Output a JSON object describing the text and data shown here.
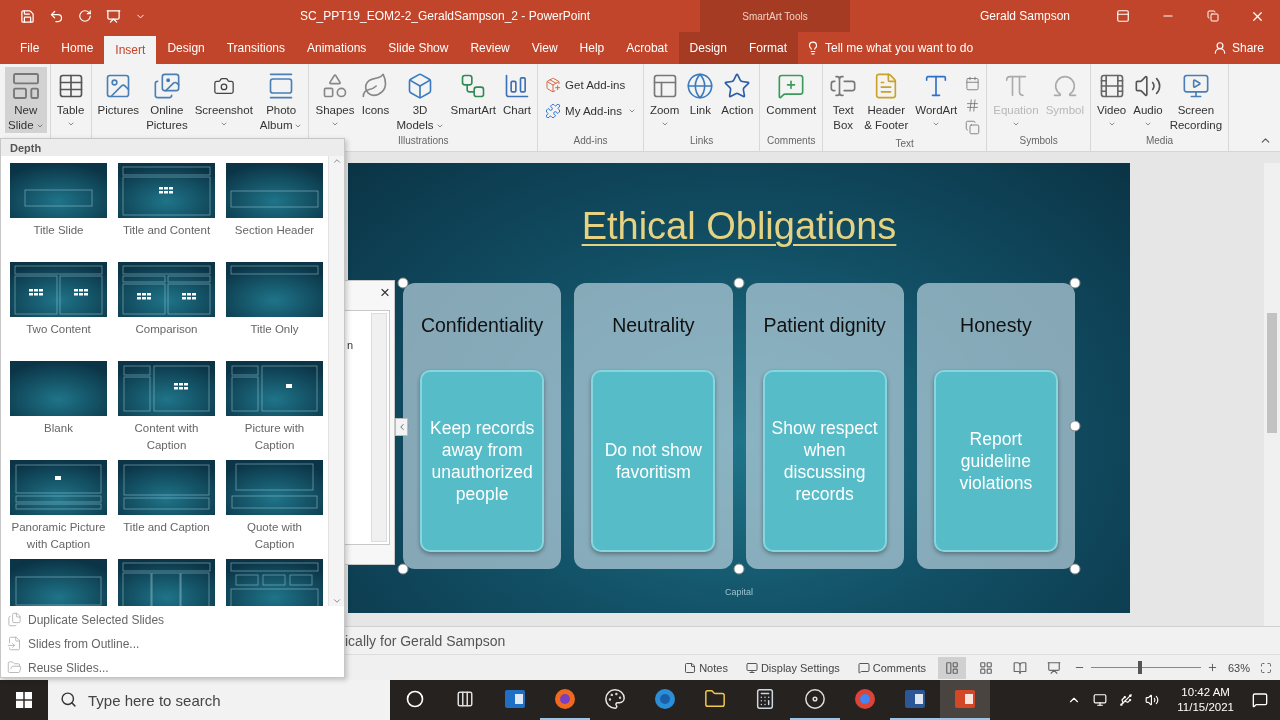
{
  "title_bar": {
    "document_title": "SC_PPT19_EOM2-2_GeraldSampson_2 - PowerPoint",
    "contextual_group": "SmartArt Tools",
    "user": "Gerald Sampson"
  },
  "tabs": [
    {
      "label": "File",
      "selected": false,
      "contextual": false
    },
    {
      "label": "Home",
      "selected": false,
      "contextual": false
    },
    {
      "label": "Insert",
      "selected": true,
      "contextual": false
    },
    {
      "label": "Design",
      "selected": false,
      "contextual": false
    },
    {
      "label": "Transitions",
      "selected": false,
      "contextual": false
    },
    {
      "label": "Animations",
      "selected": false,
      "contextual": false
    },
    {
      "label": "Slide Show",
      "selected": false,
      "contextual": false
    },
    {
      "label": "Review",
      "selected": false,
      "contextual": false
    },
    {
      "label": "View",
      "selected": false,
      "contextual": false
    },
    {
      "label": "Help",
      "selected": false,
      "contextual": false
    },
    {
      "label": "Acrobat",
      "selected": false,
      "contextual": false
    },
    {
      "label": "Design",
      "selected": false,
      "contextual": true
    },
    {
      "label": "Format",
      "selected": false,
      "contextual": true
    }
  ],
  "tell_me": {
    "placeholder": "Tell me what you want to do"
  },
  "share": "Share",
  "ribbon": {
    "groups": [
      {
        "buttons": [
          {
            "kind": "large",
            "label": "New\nSlide",
            "has_menu": true,
            "pressed": true,
            "disabled": false
          }
        ]
      },
      {
        "buttons": [
          {
            "kind": "large",
            "label": "Table",
            "has_menu": true,
            "pressed": false,
            "disabled": false
          }
        ]
      },
      {
        "buttons": [
          {
            "kind": "large",
            "label": "Pictures",
            "has_menu": false,
            "pressed": false,
            "disabled": false
          },
          {
            "kind": "large",
            "label": "Online\nPictures",
            "has_menu": false,
            "pressed": false,
            "disabled": false
          },
          {
            "kind": "large",
            "label": "Screenshot",
            "has_menu": true,
            "pressed": false,
            "disabled": false
          },
          {
            "kind": "large",
            "label": "Photo\nAlbum",
            "has_menu": true,
            "pressed": false,
            "disabled": false
          }
        ]
      },
      {
        "label": "Illustrations",
        "buttons": [
          {
            "kind": "large",
            "label": "Shapes",
            "has_menu": true,
            "pressed": false,
            "disabled": false
          },
          {
            "kind": "large",
            "label": "Icons",
            "has_menu": false,
            "pressed": false,
            "disabled": false
          },
          {
            "kind": "large",
            "label": "3D\nModels",
            "has_menu": true,
            "pressed": false,
            "disabled": false
          },
          {
            "kind": "large",
            "label": "SmartArt",
            "has_menu": false,
            "pressed": false,
            "disabled": false
          },
          {
            "kind": "large",
            "label": "Chart",
            "has_menu": false,
            "pressed": false,
            "disabled": false
          }
        ]
      },
      {
        "label": "Add-ins",
        "buttons": [
          {
            "kind": "small",
            "label": "Get Add-ins",
            "has_menu": false,
            "pressed": false,
            "disabled": false
          },
          {
            "kind": "small",
            "label": "My Add-ins",
            "has_menu": true,
            "pressed": false,
            "disabled": false
          }
        ]
      },
      {
        "label": "Links",
        "buttons": [
          {
            "kind": "large",
            "label": "Zoom",
            "has_menu": true,
            "pressed": false,
            "disabled": false
          },
          {
            "kind": "large",
            "label": "Link",
            "has_menu": false,
            "pressed": false,
            "disabled": false
          },
          {
            "kind": "large",
            "label": "Action",
            "has_menu": false,
            "pressed": false,
            "disabled": false
          }
        ]
      },
      {
        "label": "Comments",
        "buttons": [
          {
            "kind": "large",
            "label": "Comment",
            "has_menu": false,
            "pressed": false,
            "disabled": false
          }
        ]
      },
      {
        "label": "Text",
        "buttons": [
          {
            "kind": "large",
            "label": "Text\nBox",
            "has_menu": false,
            "pressed": false,
            "disabled": false
          },
          {
            "kind": "large",
            "label": "Header\n& Footer",
            "has_menu": false,
            "pressed": false,
            "disabled": false
          },
          {
            "kind": "large",
            "label": "WordArt",
            "has_menu": true,
            "pressed": false,
            "disabled": false
          },
          {
            "kind": "icon",
            "pressed": false,
            "disabled": false
          },
          {
            "kind": "icon",
            "pressed": false,
            "disabled": false
          },
          {
            "kind": "icon",
            "pressed": false,
            "disabled": false
          }
        ]
      },
      {
        "label": "Symbols",
        "buttons": [
          {
            "kind": "large",
            "label": "Equation",
            "has_menu": true,
            "pressed": false,
            "disabled": true
          },
          {
            "kind": "large",
            "label": "Symbol",
            "has_menu": false,
            "pressed": false,
            "disabled": true
          }
        ]
      },
      {
        "label": "Media",
        "buttons": [
          {
            "kind": "large",
            "label": "Video",
            "has_menu": true,
            "pressed": false,
            "disabled": false
          },
          {
            "kind": "large",
            "label": "Audio",
            "has_menu": true,
            "pressed": false,
            "disabled": false
          },
          {
            "kind": "large",
            "label": "Screen\nRecording",
            "has_menu": false,
            "pressed": false,
            "disabled": false
          }
        ]
      }
    ]
  },
  "layout_gallery": {
    "header": "Depth",
    "layouts": [
      {
        "kind": "labeled",
        "label": "Title Slide"
      },
      {
        "kind": "labeled",
        "label": "Title and Content"
      },
      {
        "kind": "labeled",
        "label": "Section Header"
      },
      {
        "kind": "labeled",
        "label": "Two Content"
      },
      {
        "kind": "labeled",
        "label": "Comparison"
      },
      {
        "kind": "labeled",
        "label": "Title Only"
      },
      {
        "kind": "labeled",
        "label": "Blank"
      },
      {
        "kind": "labeled",
        "label": "Content with Caption"
      },
      {
        "kind": "labeled",
        "label": "Picture with Caption"
      },
      {
        "kind": "labeled",
        "label": "Panoramic Picture with Caption"
      },
      {
        "kind": "labeled",
        "label": "Title and Caption"
      },
      {
        "kind": "labeled",
        "label": "Quote with Caption"
      },
      {
        "kind": "cut"
      },
      {
        "kind": "cut"
      },
      {
        "kind": "cut"
      }
    ],
    "commands": [
      "Duplicate Selected Slides",
      "Slides from Outline...",
      "Reuse Slides..."
    ]
  },
  "slide": {
    "title": "Ethical Obligations",
    "footer": "Capital",
    "smartart": {
      "selected": true,
      "items": [
        {
          "heading": "Confidentiality",
          "body": "Keep records away from unauthorized people"
        },
        {
          "heading": "Neutrality",
          "body": "Do not show favoritism"
        },
        {
          "heading": "Patient dignity",
          "body": "Show respect when discussing records"
        },
        {
          "heading": "Honesty",
          "body": "Report guideline violations"
        }
      ]
    }
  },
  "text_pane": {
    "close": "×",
    "fragment": "n"
  },
  "notes": "ically for Gerald Sampson",
  "status_bar": {
    "buttons": [
      "Notes",
      "Display Settings",
      "Comments"
    ],
    "views": [
      {
        "selected": true
      },
      {
        "selected": false
      },
      {
        "selected": false
      },
      {
        "selected": false
      }
    ],
    "zoom": {
      "level": 0.45,
      "reading": "63%"
    }
  },
  "taskbar": {
    "search": {
      "placeholder": "Type here to search"
    },
    "apps": [
      {
        "running": false,
        "selected": false
      },
      {
        "running": true,
        "selected": false
      },
      {
        "running": false,
        "selected": false
      },
      {
        "running": false,
        "selected": false
      },
      {
        "running": false,
        "selected": false
      },
      {
        "running": false,
        "selected": false
      },
      {
        "running": true,
        "selected": false
      },
      {
        "running": false,
        "selected": false
      },
      {
        "running": true,
        "selected": false
      },
      {
        "running": true,
        "selected": true
      }
    ],
    "time": "10:42 AM",
    "date": "11/15/2021"
  }
}
